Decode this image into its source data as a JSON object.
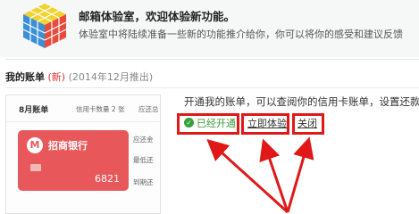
{
  "header": {
    "title": "邮箱体验室，欢迎体验新功能。",
    "description": "体验室中将陆续准备一些新的功能推介给你，你可以将你的感受和建议反馈"
  },
  "section": {
    "heading": "我的账单",
    "badge": "(新)",
    "date": "(2014年12月推出)"
  },
  "preview": {
    "month": "8月账单",
    "card_count": "信用卡数量 2 张",
    "due": "应还总",
    "bank_name": "招商银行",
    "card_last4": "6821",
    "side_labels": [
      "应还金",
      "最低还",
      "到期还"
    ]
  },
  "feature": {
    "message": "开通我的账单，可以查阅你的信用卡账单，设置还款",
    "status": "已经开通",
    "try_now": "立即体验",
    "close": "关闭"
  },
  "colors": {
    "highlight": "#e01818",
    "enabled": "#3d9a3d",
    "card": "#e8585a",
    "new_badge": "#d33333"
  }
}
